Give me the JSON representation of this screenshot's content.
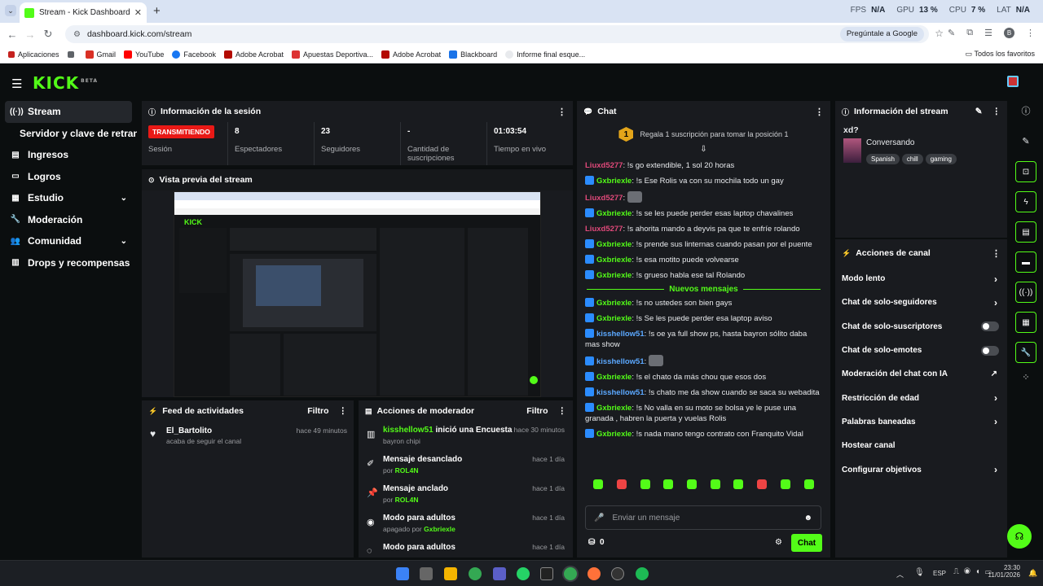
{
  "browser": {
    "tab_title": "Stream - Kick Dashboard",
    "url": "dashboard.kick.com/stream",
    "ask_google": "Pregúntale a Google",
    "profile_initial": "B",
    "perf": [
      {
        "label": "FPS",
        "value": "N/A"
      },
      {
        "label": "GPU",
        "value": "13 %"
      },
      {
        "label": "CPU",
        "value": "7 %"
      },
      {
        "label": "LAT",
        "value": "N/A"
      }
    ],
    "bookmarks": [
      "Aplicaciones",
      "Gmail",
      "YouTube",
      "Facebook",
      "Adobe Acrobat",
      "Apuestas Deportiva...",
      "Adobe Acrobat",
      "Blackboard",
      "Informe final esque..."
    ],
    "all_favs": "Todos los favoritos"
  },
  "brand": {
    "logo": "KICK",
    "beta": "BETA"
  },
  "sidebar": [
    {
      "label": "Stream",
      "icon": "stream-icon",
      "active": true
    },
    {
      "label": "Servidor y clave de retransm",
      "sub": true
    },
    {
      "label": "Ingresos",
      "icon": "income-icon"
    },
    {
      "label": "Logros",
      "icon": "trophy-icon"
    },
    {
      "label": "Estudio",
      "icon": "studio-icon",
      "chevron": true
    },
    {
      "label": "Moderación",
      "icon": "wrench-icon"
    },
    {
      "label": "Comunidad",
      "icon": "community-icon",
      "chevron": true
    },
    {
      "label": "Drops y recompensas",
      "icon": "gift-icon"
    }
  ],
  "session": {
    "title": "Información de la sesión",
    "live_badge": "TRANSMITIENDO",
    "stats": [
      {
        "value": "",
        "label": "Sesión"
      },
      {
        "value": "8",
        "label": "Espectadores"
      },
      {
        "value": "23",
        "label": "Seguidores"
      },
      {
        "value": "-",
        "label": "Cantidad de suscripciones"
      },
      {
        "value": "01:03:54",
        "label": "Tiempo en vivo"
      }
    ]
  },
  "preview": {
    "title": "Vista previa del stream"
  },
  "activity": {
    "title": "Feed de actividades",
    "filter": "Filtro",
    "items": [
      {
        "name": "El_Bartolito",
        "desc": "acaba de seguir el canal",
        "time": "hace 49 minutos"
      }
    ]
  },
  "mod": {
    "title": "Acciones de moderador",
    "filter": "Filtro",
    "items": [
      {
        "user": "kisshellow51",
        "action": "inició una Encuesta",
        "sub": "bayron chipi",
        "time": "hace 30 minutos",
        "icon": "poll-icon"
      },
      {
        "action": "Mensaje desanclado",
        "by": "por",
        "user": "ROL4N",
        "time": "hace 1 día",
        "icon": "unpin-icon"
      },
      {
        "action": "Mensaje anclado",
        "by": "por",
        "user": "ROL4N",
        "time": "hace 1 día",
        "icon": "pin-icon"
      },
      {
        "action": "Modo para adultos",
        "by": "apagado por",
        "user": "Gxbriexle",
        "time": "hace 1 día",
        "icon": "eye-icon"
      },
      {
        "action": "Modo para adultos",
        "time": "hace 1 día",
        "icon": "eye-off-icon"
      }
    ]
  },
  "chat": {
    "title": "Chat",
    "gift_rank": "1",
    "gift_text": "Regala 1 suscripción para tomar la posición 1",
    "new_messages": "Nuevos mensajes",
    "messages_before": [
      {
        "user": "Liuxd5277",
        "color": "pink",
        "text": "!s go extendible, 1 sol 20 horas"
      },
      {
        "user": "Gxbriexle",
        "color": "green",
        "badge": true,
        "text": "!s Ese Rolis va con su mochila todo un gay"
      },
      {
        "user": "Liuxd5277",
        "color": "pink",
        "text": "",
        "emote": true
      },
      {
        "user": "Gxbriexle",
        "color": "green",
        "badge": true,
        "text": "!s se les puede perder esas laptop chavalines"
      },
      {
        "user": "Liuxd5277",
        "color": "pink",
        "text": "!s ahorita mando a deyvis pa que te enfríe rolando"
      },
      {
        "user": "Gxbriexle",
        "color": "green",
        "badge": true,
        "text": "!s prende sus linternas cuando pasan por el puente"
      },
      {
        "user": "Gxbriexle",
        "color": "green",
        "badge": true,
        "text": "!s esa motito puede volvearse"
      },
      {
        "user": "Gxbriexle",
        "color": "green",
        "badge": true,
        "text": "!s grueso habla ese tal Rolando"
      }
    ],
    "messages_after": [
      {
        "user": "Gxbriexle",
        "color": "green",
        "badge": true,
        "text": "!s no ustedes son bien gays"
      },
      {
        "user": "Gxbriexle",
        "color": "green",
        "badge": true,
        "text": "!s Se les puede perder esa laptop aviso"
      },
      {
        "user": "kisshellow51",
        "color": "blue",
        "badge": true,
        "text": "!s oe ya full show ps, hasta bayron sólito daba mas show"
      },
      {
        "user": "kisshellow51",
        "color": "blue",
        "badge": true,
        "text": "",
        "emote": true
      },
      {
        "user": "Gxbriexle",
        "color": "green",
        "badge": true,
        "text": "!s el chato da más chou que esos dos"
      },
      {
        "user": "kisshellow51",
        "color": "blue",
        "badge": true,
        "text": "!s chato me da show cuando se saca su webadita"
      },
      {
        "user": "Gxbriexle",
        "color": "green",
        "badge": true,
        "text": "!s No valla en su moto se bolsa ye le puse una granada , habren la puerta y vuelas Rolis"
      },
      {
        "user": "Gxbriexle",
        "color": "green",
        "badge": true,
        "text": "!s nada mano tengo contrato con Franquito Vidal"
      }
    ],
    "input_placeholder": "Enviar un mensaje",
    "points": "0",
    "send": "Chat"
  },
  "streaminfo": {
    "title": "Información del stream",
    "stream_title": "xd?",
    "category": "Conversando",
    "tags": [
      "Spanish",
      "chill",
      "gaming"
    ]
  },
  "channel": {
    "title": "Acciones de canal",
    "items": [
      {
        "label": "Modo lento",
        "ctl": "arrow"
      },
      {
        "label": "Chat de solo-seguidores",
        "ctl": "arrow"
      },
      {
        "label": "Chat de solo-suscriptores",
        "ctl": "toggle"
      },
      {
        "label": "Chat de solo-emotes",
        "ctl": "toggle"
      },
      {
        "label": "Moderación del chat con IA",
        "ctl": "ext"
      },
      {
        "label": "Restricción de edad",
        "ctl": "arrow"
      },
      {
        "label": "Palabras baneadas",
        "ctl": "arrow"
      },
      {
        "label": "Hostear canal",
        "ctl": "none"
      },
      {
        "label": "Configurar objetivos",
        "ctl": "arrow"
      }
    ]
  },
  "taskbar": {
    "lang": "ESP",
    "time": "23:30",
    "date": "11/01/2026"
  }
}
